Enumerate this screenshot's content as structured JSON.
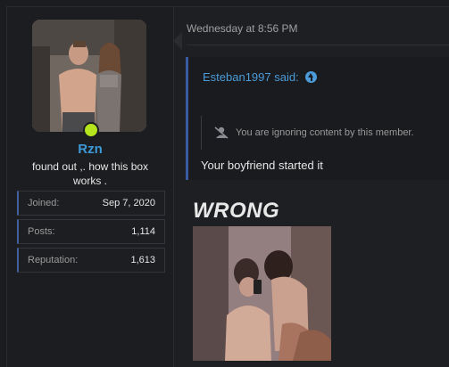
{
  "post": {
    "timestamp": "Wednesday at 8:56 PM",
    "user": {
      "username": "Rzn",
      "user_title": "found out ,. how this box works .",
      "avatar_icon": "avatar-photo",
      "online": true,
      "stats": [
        {
          "label": "Joined:",
          "value": "Sep 7, 2020"
        },
        {
          "label": "Posts:",
          "value": "1,114"
        },
        {
          "label": "Reputation:",
          "value": "1,613"
        }
      ]
    },
    "quote": {
      "author_said": "Esteban1997 said:",
      "ignored_message": "You are ignoring content by this member.",
      "body": "Your boyfriend started it"
    },
    "reply_text": "WRONG",
    "image_icon": "embedded-photo"
  },
  "colors": {
    "accent_link": "#4a9bd8",
    "username": "#3d9ad9",
    "online": "#b5e51d",
    "quote_border": "#3a5b9f"
  }
}
